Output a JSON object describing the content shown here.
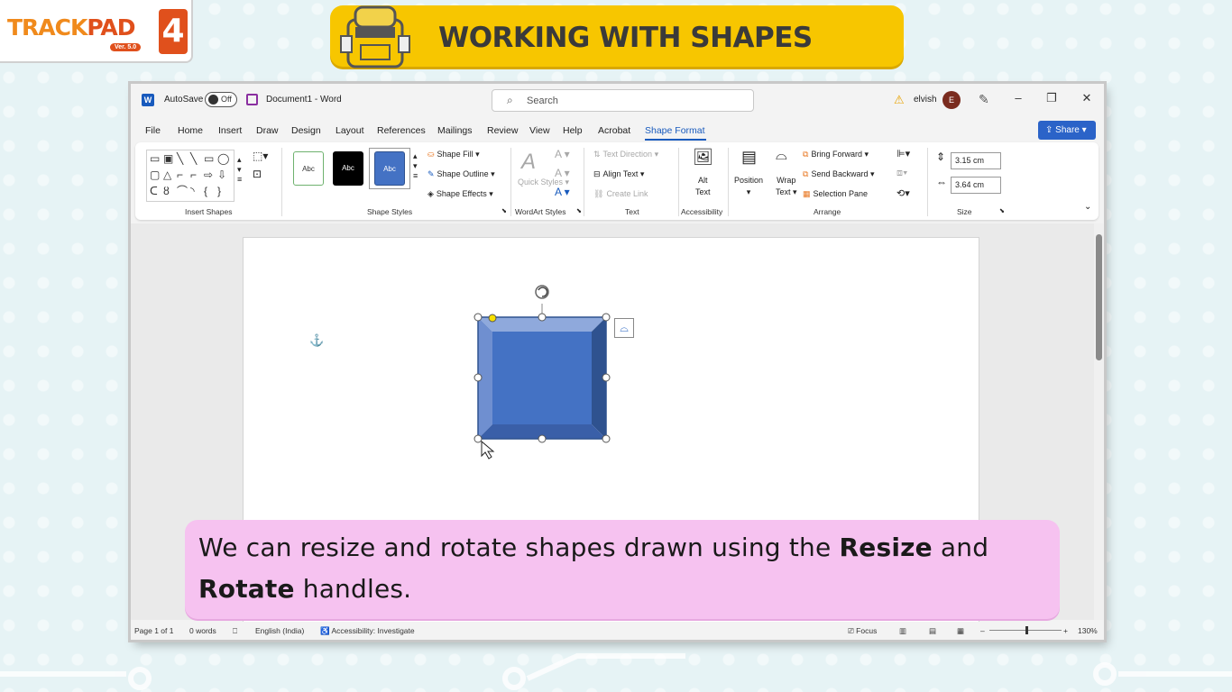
{
  "brand": {
    "logo_part1": "TRACK",
    "logo_part2": "PAD",
    "version": "Ver. 5.0",
    "level": "4"
  },
  "banner": {
    "title": "WORKING WITH SHAPES"
  },
  "word": {
    "autosave_label": "AutoSave",
    "autosave_state": "Off",
    "document_title": "Document1 - Word",
    "search_placeholder": "Search",
    "user_name": "elvish",
    "avatar_initial": "E",
    "menu": [
      "File",
      "Home",
      "Insert",
      "Draw",
      "Design",
      "Layout",
      "References",
      "Mailings",
      "Review",
      "View",
      "Help",
      "Acrobat",
      "Shape Format"
    ],
    "active_menu": "Shape Format",
    "share_label": "Share",
    "ribbon": {
      "insert_shapes_label": "Insert Shapes",
      "shape_styles_label": "Shape Styles",
      "style_sample": "Abc",
      "shape_fill": "Shape Fill",
      "shape_outline": "Shape Outline",
      "shape_effects": "Shape Effects",
      "quick_styles": "Quick Styles",
      "wordart_styles_label": "WordArt Styles",
      "text_direction": "Text Direction",
      "align_text": "Align Text",
      "create_link": "Create Link",
      "text_label": "Text",
      "alt_text_line1": "Alt",
      "alt_text_line2": "Text",
      "accessibility_label": "Accessibility",
      "position": "Position",
      "wrap_text_line1": "Wrap",
      "wrap_text_line2": "Text",
      "bring_forward": "Bring Forward",
      "send_backward": "Send Backward",
      "selection_pane": "Selection Pane",
      "arrange_label": "Arrange",
      "height_value": "3.15 cm",
      "width_value": "3.64 cm",
      "size_label": "Size"
    },
    "status": {
      "page": "Page 1 of 1",
      "words": "0 words",
      "language": "English (India)",
      "accessibility": "Accessibility: Investigate",
      "focus": "Focus",
      "zoom": "130%"
    }
  },
  "caption": {
    "line1_a": "We can resize and rotate shapes drawn using the ",
    "line1_b": "Resize",
    "line1_c": " and",
    "line2_a": "Rotate",
    "line2_b": " handles."
  },
  "colors": {
    "banner": "#f7c600",
    "caption_bg": "#f6c2f0",
    "word_blue": "#185abd",
    "shape_fill": "#4472c4"
  }
}
